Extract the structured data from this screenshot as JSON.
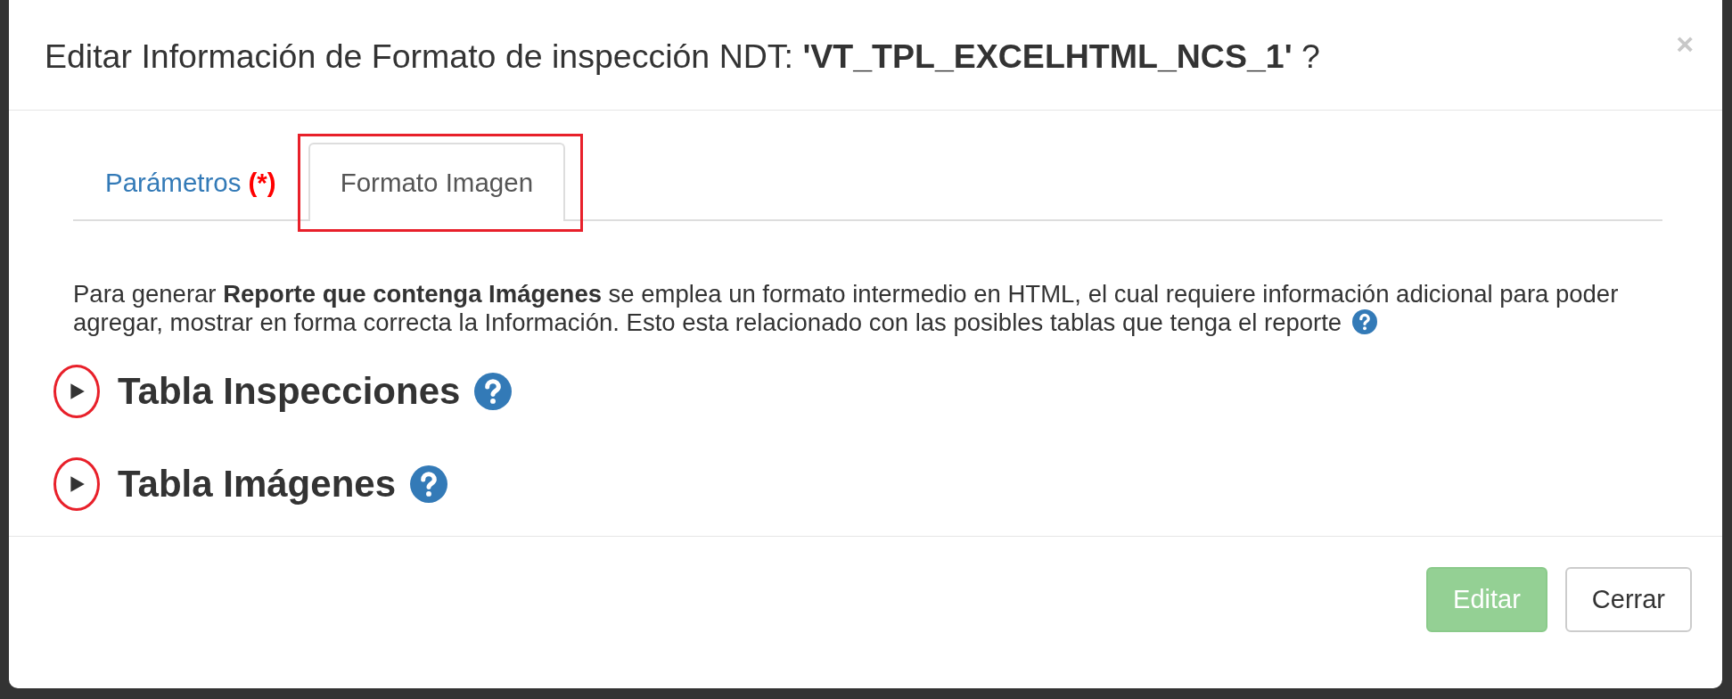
{
  "dialog": {
    "title": "Editar Información de Formato de inspección NDT: **'VT_TPL_EXCELHTML_NCS_1'** ?",
    "close": "×"
  },
  "tabs": [
    {
      "label": "Parámetros",
      "required_mark": "(*)",
      "selected": false,
      "highlighted": false
    },
    {
      "label": "Formato Imagen",
      "selected": true,
      "highlighted": true
    }
  ],
  "description": "Para generar **Reporte que contenga Imágenes** se emplea un formato intermedio en HTML, el cual requiere información adicional para poder agregar, mostrar en forma correcta la Información. Esto esta relacionado con las posibles tablas que tenga el reporte",
  "sections": [
    {
      "title": "Tabla Inspecciones",
      "expanded": false,
      "highlighted": true
    },
    {
      "title": "Tabla Imágenes",
      "expanded": false,
      "highlighted": true
    }
  ],
  "buttons": [
    {
      "label": "Editar",
      "kind": "primary",
      "disabled": true
    },
    {
      "label": "Cerrar",
      "kind": "default",
      "disabled": false
    }
  ]
}
